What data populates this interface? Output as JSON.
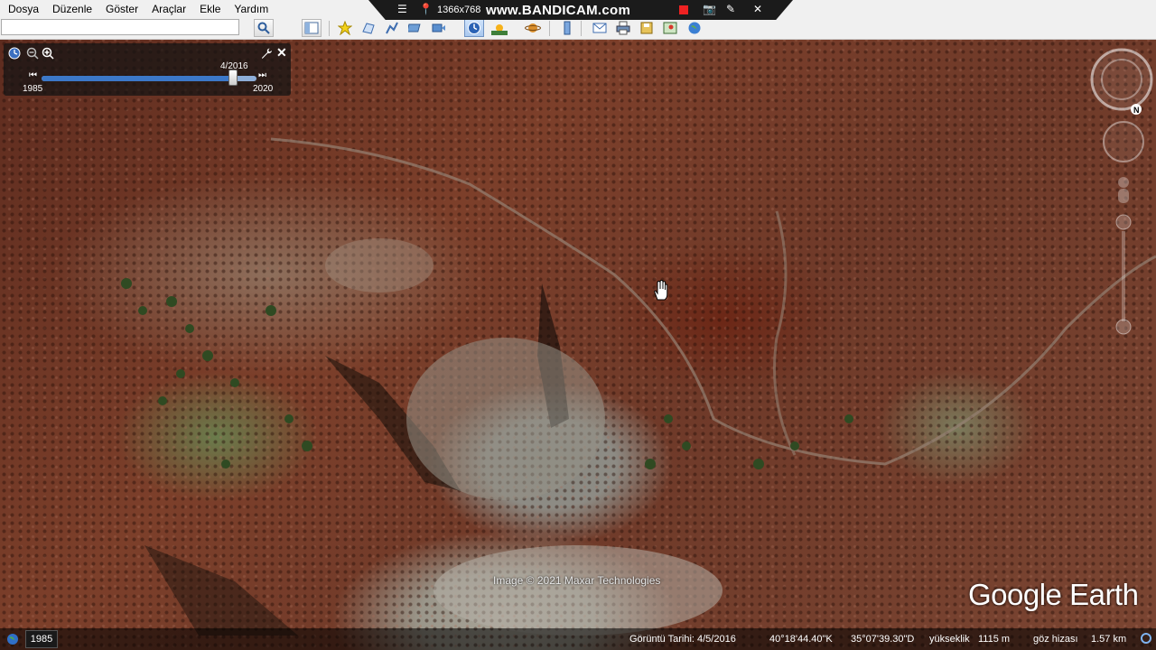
{
  "menu": [
    "Dosya",
    "Düzenle",
    "Göster",
    "Araçlar",
    "Ekle",
    "Yardım"
  ],
  "search": {
    "value": "",
    "placeholder": ""
  },
  "toolbar": {
    "icons": [
      "search-icon",
      "sidebar-toggle-icon",
      "placemark-icon",
      "polygon-icon",
      "path-icon",
      "image-overlay-icon",
      "record-tour-icon",
      "historical-imagery-icon",
      "sunlight-icon",
      "planets-icon",
      "ruler-icon",
      "email-icon",
      "print-icon",
      "save-image-icon",
      "maps-icon",
      "earth-view-icon"
    ]
  },
  "bandicam": {
    "resolution": "1366x768",
    "logo": "www.BANDICAM.com"
  },
  "time_slider": {
    "current_date": "4/2016",
    "start_year": "1985",
    "end_year": "2020",
    "position_fraction": 0.89
  },
  "map": {
    "attribution": "Image © 2021 Maxar Technologies",
    "brand": "Google Earth"
  },
  "status_bar": {
    "year_badge": "1985",
    "imagery_date": "Görüntü Tarihi: 4/5/2016",
    "latitude": "40°18'44.40\"K",
    "longitude": "35°07'39.30\"D",
    "elevation_label": "yükseklik",
    "elevation_value": "1115 m",
    "eye_alt_label": "göz hizası",
    "eye_alt_value": "1.57 km"
  }
}
